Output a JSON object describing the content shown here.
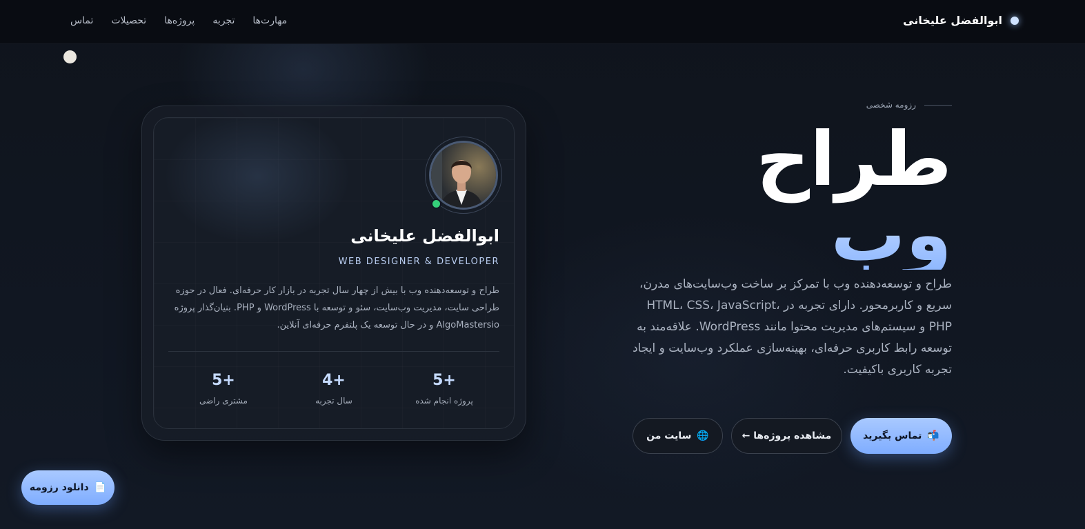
{
  "nav": {
    "brand": "ابوالفضل علیخانی",
    "links": [
      "مهارت‌ها",
      "تجربه",
      "پروژه‌ها",
      "تحصیلات",
      "تماس"
    ]
  },
  "hero": {
    "eyebrow": "رزومه شخصی",
    "title_line1": "طراح",
    "title_line2": "وب",
    "description": "طراح و توسعه‌دهنده وب با تمرکز بر ساخت وب‌سایت‌های مدرن، سریع و کاربرمحور. دارای تجربه در HTML، CSS، JavaScript، PHP و سیستم‌های مدیریت محتوا مانند WordPress. علاقه‌مند به توسعه رابط کاربری حرفه‌ای، بهینه‌سازی عملکرد وب‌سایت و ایجاد تجربه کاربری باکیفیت.",
    "buttons": {
      "contact": "تماس بگیرید",
      "contact_icon": "📬",
      "projects": "مشاهده پروژه‌ها ←",
      "site": "سایت من",
      "site_icon": "🌐"
    }
  },
  "card": {
    "name": "ابوالفضل علیخانی",
    "role": "WEB DESIGNER & DEVELOPER",
    "description": "طراح و توسعه‌دهنده وب با بیش از چهار سال تجربه در بازار کار حرفه‌ای. فعال در حوزه طراحی سایت، مدیریت وب‌سایت، سئو و توسعه با WordPress و PHP. بنیان‌گذار پروژه AlgoMastersio و در حال توسعه یک پلتفرم حرفه‌ای آنلاین.",
    "stats": [
      {
        "value": "5+",
        "label": "پروژه انجام شده"
      },
      {
        "value": "4+",
        "label": "سال تجربه"
      },
      {
        "value": "5+",
        "label": "مشتری راضی"
      }
    ]
  },
  "download": {
    "label": "دانلود رزومه",
    "icon": "📄"
  },
  "colors": {
    "accent": "#8fb8ff",
    "background": "#0d1118",
    "online": "#35d07a"
  }
}
